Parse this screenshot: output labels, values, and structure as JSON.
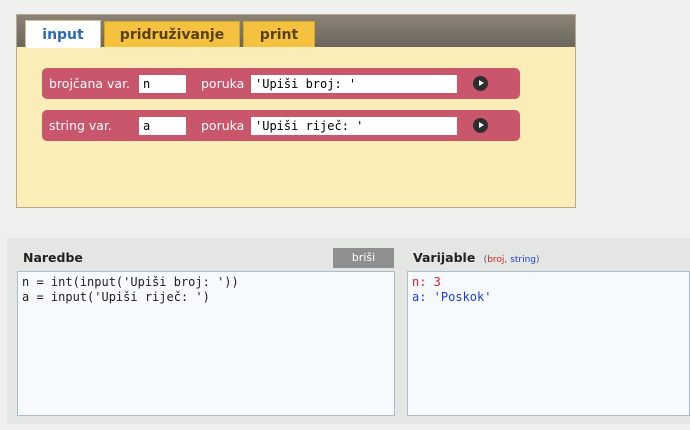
{
  "tabs": [
    {
      "label": "input",
      "active": true
    },
    {
      "label": "pridruživanje",
      "active": false
    },
    {
      "label": "print",
      "active": false
    }
  ],
  "input_rows": [
    {
      "var_label": "brojčana var.",
      "var_value": "n",
      "message_label": "poruka",
      "message_value": "'Upiši broj: '"
    },
    {
      "var_label": "string var.",
      "var_value": "a",
      "message_label": "poruka",
      "message_value": "'Upiši riječ: '"
    }
  ],
  "commands": {
    "title": "Naredbe",
    "clear_label": "briši",
    "lines": [
      "n = int(input('Upiši broj: '))",
      "a = input('Upiši riječ: ')"
    ]
  },
  "variables": {
    "title": "Varijable",
    "legend_open": "(",
    "legend_num": "broj",
    "legend_sep": ", ",
    "legend_str": "string",
    "legend_close": ")",
    "items": [
      {
        "text": "n: 3",
        "kind": "number"
      },
      {
        "text": "a: 'Poskok'",
        "kind": "string"
      }
    ]
  },
  "colors": {
    "panel_bg": "#fbedb8",
    "row_bg": "#c9566a",
    "tab_active_text": "#2a6ab8",
    "tab_inactive_bg": "#f4c23f",
    "number_var": "#d21f1f",
    "string_var": "#1d3fcc"
  },
  "icons": {
    "run": "play-circle-icon"
  }
}
